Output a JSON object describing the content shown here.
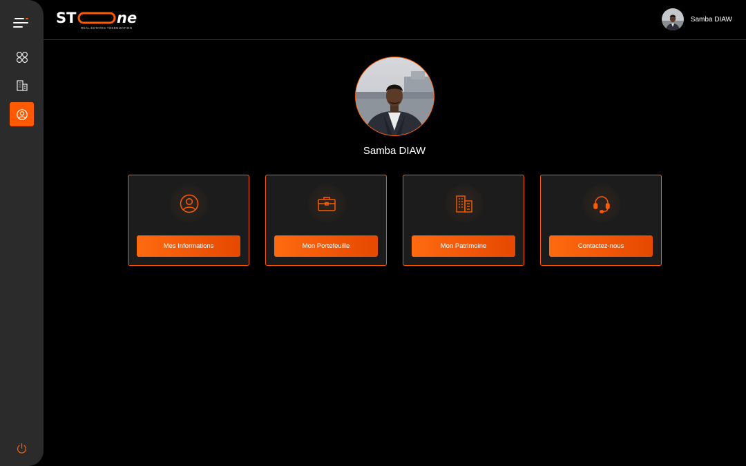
{
  "brand": {
    "logo_text": "STOONE",
    "logo_subtitle": "REAL ESTATES TOKENIZATION",
    "accent_color": "#ff5a00"
  },
  "sidebar": {
    "items": [
      {
        "name": "dashboard",
        "icon": "grid-icon",
        "active": false
      },
      {
        "name": "buildings",
        "icon": "building-icon",
        "active": false
      },
      {
        "name": "profile",
        "icon": "user-circle-icon",
        "active": true
      }
    ],
    "logout_icon": "power-icon"
  },
  "header": {
    "user_name": "Samba DIAW"
  },
  "profile": {
    "name": "Samba DIAW"
  },
  "cards": [
    {
      "icon": "user-circle-icon",
      "label": "Mes Informations"
    },
    {
      "icon": "briefcase-icon",
      "label": "Mon Portefeuille"
    },
    {
      "icon": "building-icon",
      "label": "Mon Patrimoine"
    },
    {
      "icon": "headset-icon",
      "label": "Contactez-nous"
    }
  ]
}
